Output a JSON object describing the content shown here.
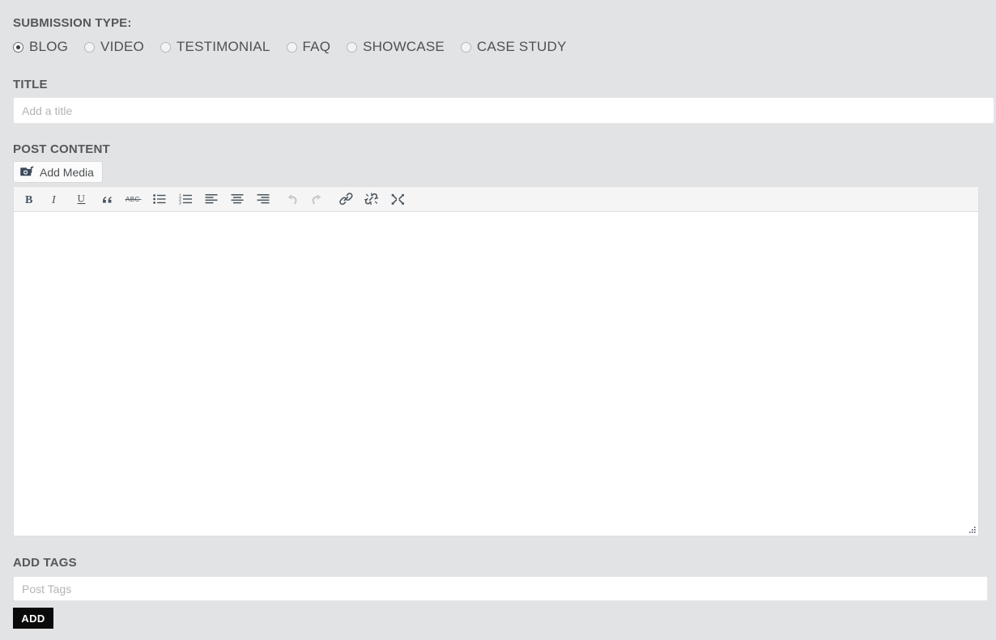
{
  "colors": {
    "page_background": "#e2e3e4",
    "label_text": "#555759",
    "input_background": "#ffffff",
    "toolbar_background": "#f5f5f5",
    "icon": "#49545e",
    "icon_disabled": "#c6c9cc",
    "add_button_background": "#0a0a0a",
    "add_button_text": "#ffffff"
  },
  "submission_type": {
    "label": "SUBMISSION TYPE:",
    "options": [
      {
        "label": "BLOG",
        "checked": true
      },
      {
        "label": "VIDEO",
        "checked": false
      },
      {
        "label": "TESTIMONIAL",
        "checked": false
      },
      {
        "label": "FAQ",
        "checked": false
      },
      {
        "label": "SHOWCASE",
        "checked": false
      },
      {
        "label": "CASE STUDY",
        "checked": false
      }
    ]
  },
  "title": {
    "label": "TITLE",
    "placeholder": "Add a title",
    "value": ""
  },
  "post_content": {
    "label": "POST CONTENT",
    "add_media_label": "Add Media",
    "add_media_icon": "add-media-icon",
    "editor_value": "",
    "toolbar": [
      {
        "name": "bold",
        "icon": "bold-icon",
        "label": "B",
        "disabled": false
      },
      {
        "name": "italic",
        "icon": "italic-icon",
        "label": "I",
        "disabled": false
      },
      {
        "name": "underline",
        "icon": "underline-icon",
        "label": "U",
        "disabled": false
      },
      {
        "name": "blockquote",
        "icon": "blockquote-icon",
        "label": "“",
        "disabled": false
      },
      {
        "name": "strikethrough",
        "icon": "strikethrough-icon",
        "label": "ABC",
        "disabled": false
      },
      {
        "name": "unordered-list",
        "icon": "bullet-list-icon",
        "label": "",
        "disabled": false
      },
      {
        "name": "ordered-list",
        "icon": "numbered-list-icon",
        "label": "",
        "disabled": false
      },
      {
        "name": "align-left",
        "icon": "align-left-icon",
        "label": "",
        "disabled": false
      },
      {
        "name": "align-center",
        "icon": "align-center-icon",
        "label": "",
        "disabled": false
      },
      {
        "name": "align-right",
        "icon": "align-right-icon",
        "label": "",
        "disabled": false
      },
      {
        "name": "undo",
        "icon": "undo-icon",
        "label": "",
        "disabled": true
      },
      {
        "name": "redo",
        "icon": "redo-icon",
        "label": "",
        "disabled": true
      },
      {
        "name": "insert-link",
        "icon": "link-icon",
        "label": "",
        "disabled": false
      },
      {
        "name": "remove-link",
        "icon": "unlink-icon",
        "label": "",
        "disabled": false
      },
      {
        "name": "fullscreen",
        "icon": "fullscreen-icon",
        "label": "",
        "disabled": false
      }
    ]
  },
  "tags": {
    "label": "ADD TAGS",
    "placeholder": "Post Tags",
    "value": "",
    "add_button_label": "ADD"
  }
}
